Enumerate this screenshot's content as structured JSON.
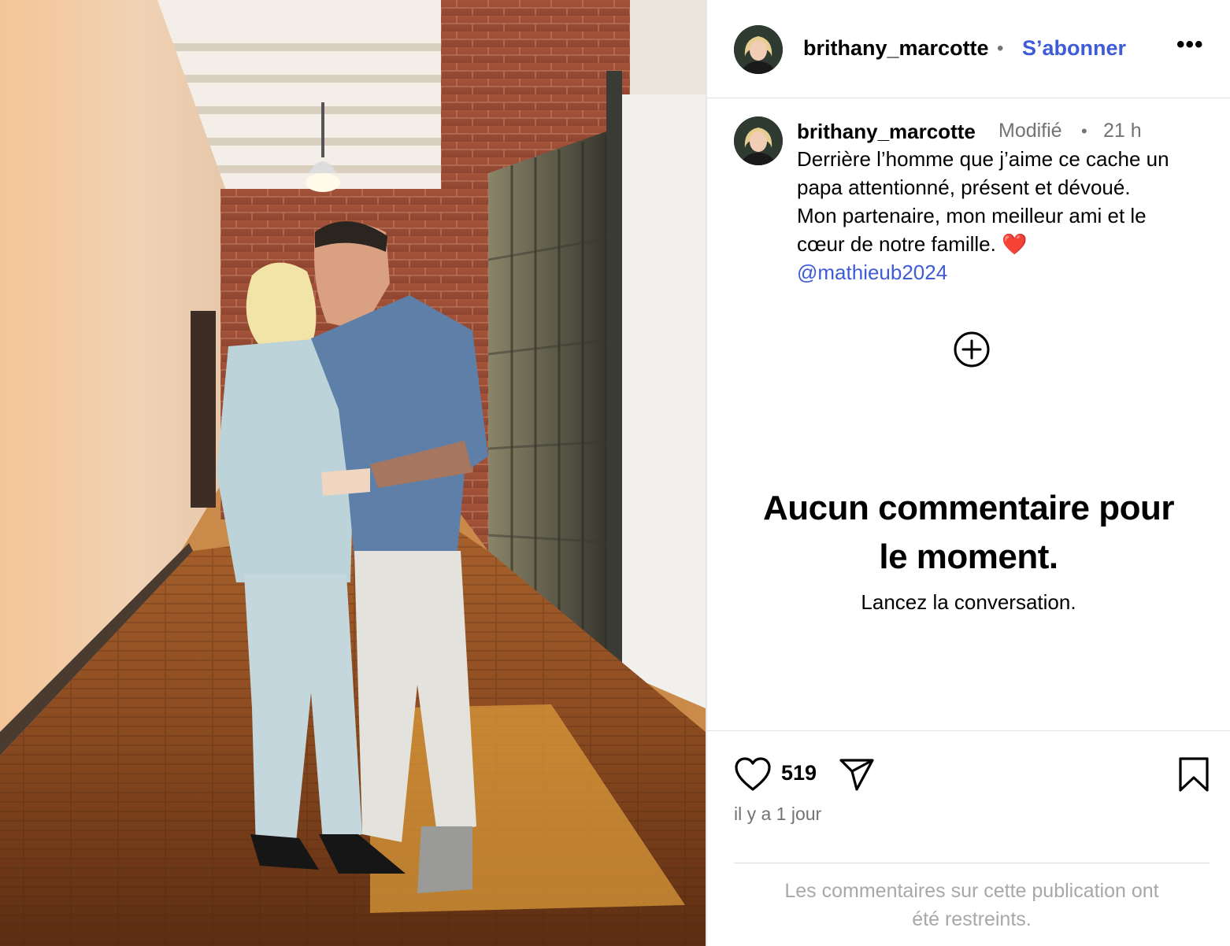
{
  "header": {
    "username": "brithany_marcotte",
    "separator": "•",
    "follow_label": "S’abonner",
    "more_label": "•••"
  },
  "caption": {
    "username": "brithany_marcotte",
    "edited_label": "Modifié",
    "separator": "•",
    "time": "21 h",
    "lines": [
      "Derrière l’homme que j’aime ce cache un",
      "papa attentionné, présent et dévoué.",
      "Mon partenaire, mon meilleur ami et le",
      "cœur de notre famille."
    ],
    "heart_emoji": "❤️",
    "mention": "@mathieub2024"
  },
  "comments": {
    "empty_title_line1": "Aucun commentaire pour",
    "empty_title_line2": "le moment.",
    "empty_subtitle": "Lancez la conversation."
  },
  "actions": {
    "like_count": "519",
    "post_date": "il y a 1 jour"
  },
  "footer": {
    "restricted_line1": "Les commentaires sur cette publication ont",
    "restricted_line2": "été restreints."
  },
  "icons": {
    "like": "heart-icon",
    "share": "send-icon",
    "save": "bookmark-icon",
    "more": "more-horizontal-icon",
    "load_more": "plus-circle-icon"
  },
  "colors": {
    "link_blue": "#3e5bd8",
    "muted_text": "#737373",
    "restricted_text": "#a8a8a8"
  }
}
